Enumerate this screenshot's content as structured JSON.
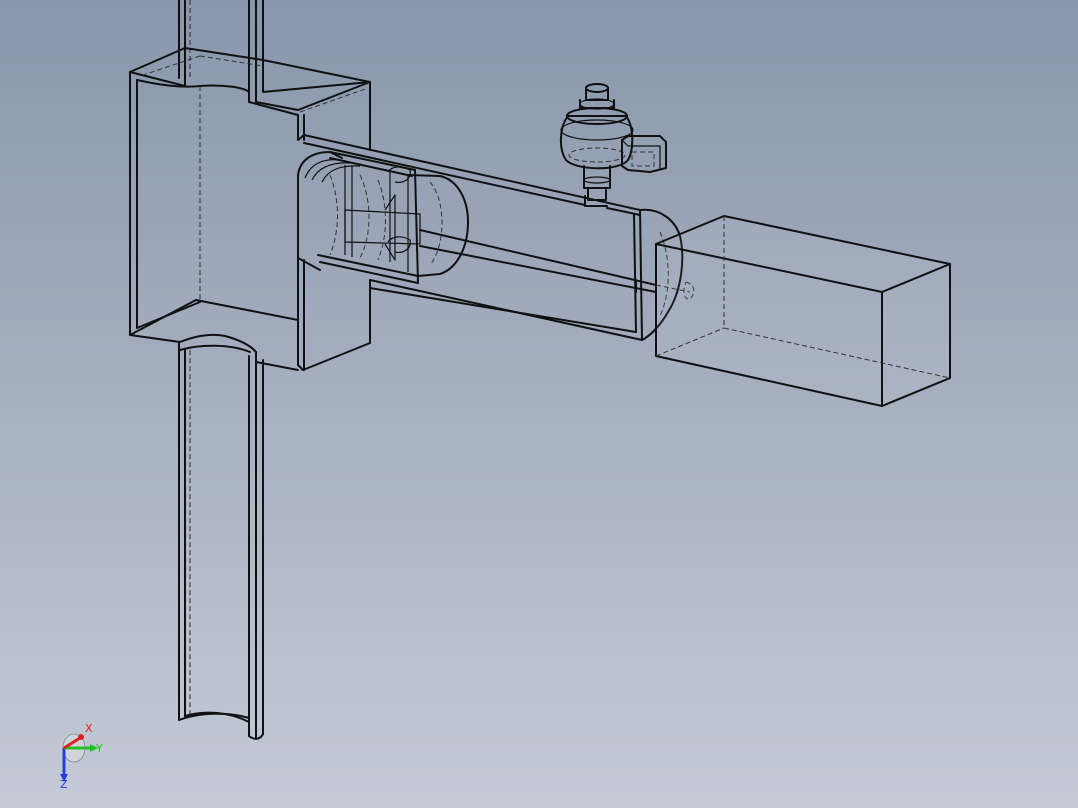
{
  "viewport": {
    "background_top": "#8996ab",
    "background_bottom": "#c4cad6",
    "edge_color": "#111111"
  },
  "triad": {
    "x_label": "X",
    "y_label": "Y",
    "z_label": "Z",
    "x_color": "#e02020",
    "y_color": "#20c020",
    "z_color": "#2040e0"
  }
}
